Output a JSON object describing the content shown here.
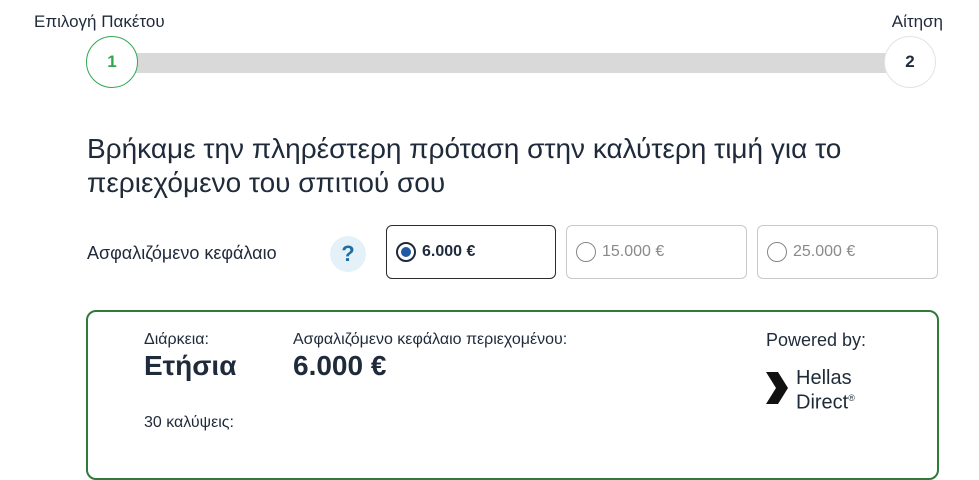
{
  "stepper": {
    "step1": {
      "label": "Επιλογή Πακέτου",
      "number": "1",
      "active": true
    },
    "step2": {
      "label": "Αίτηση",
      "number": "2",
      "active": false
    }
  },
  "headline": "Βρήκαμε την πληρέστερη πρόταση στην καλύτερη τιμή για το περιεχόμενο του σπιτιού σου",
  "capital": {
    "label": "Ασφαλιζόμενο κεφάλαιο",
    "help_glyph": "?",
    "options": [
      {
        "label": "6.000 €",
        "selected": true
      },
      {
        "label": "15.000 €",
        "selected": false
      },
      {
        "label": "25.000 €",
        "selected": false
      }
    ]
  },
  "card": {
    "duration_label": "Διάρκεια:",
    "duration_value": "Ετήσια",
    "capital_label": "Ασφαλιζόμενο κεφάλαιο περιεχομένου:",
    "capital_value": "6.000 €",
    "coverages_label": "30 καλύψεις:",
    "powered_by": "Powered by:",
    "logo": {
      "line1": "Hellas",
      "line2": "Direct",
      "mark": "®",
      "icon": "hellas-direct-chevron-icon"
    }
  },
  "colors": {
    "accent_green": "#2fa84f",
    "card_border": "#2f7a3a",
    "text": "#1f2a3a",
    "radio_fill": "#1e5aa3"
  }
}
